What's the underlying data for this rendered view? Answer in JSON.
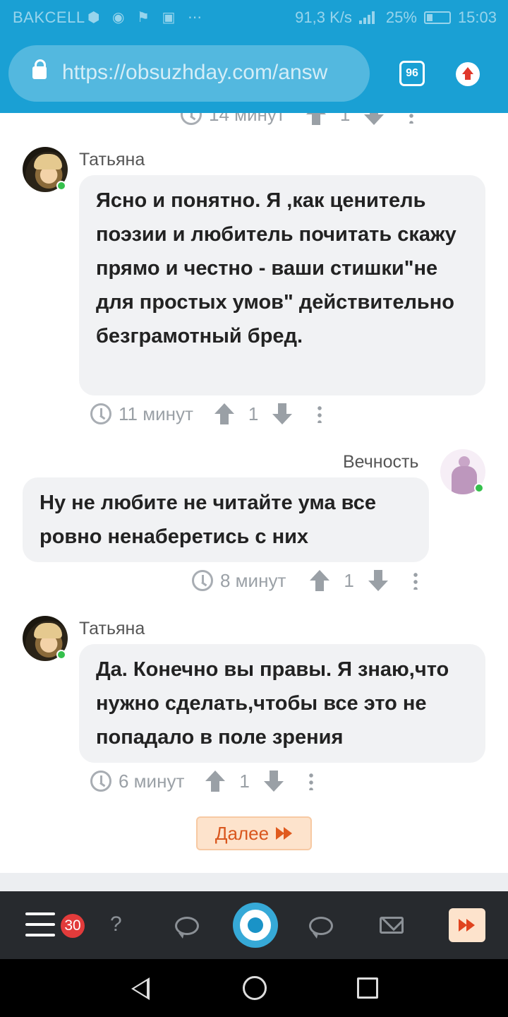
{
  "status_bar": {
    "carrier": "BAKCELL",
    "speed": "91,3 K/s",
    "battery": "25%",
    "time": "15:03"
  },
  "browser": {
    "url": "https://obsuzhday.com/answ",
    "tab_count": "96"
  },
  "comments": [
    {
      "author": "Татьяна",
      "text": "Ясно и понятно. Я ,как ценитель поэзии и любитель почитать скажу прямо и честно - ваши стишки\"не для простых умов\" действительно безграмотный бред.",
      "time": "11 минут",
      "votes": "1"
    },
    {
      "author": "Вечность",
      "text": "Ну не любите не читайте ума все ровно ненаберетись с них",
      "time": "8 минут",
      "votes": "1"
    },
    {
      "author": "Татьяна",
      "text": "Да. Конечно вы правы. Я знаю,что нужно сделать,чтобы все это не попадало в поле зрения",
      "time": "6 минут",
      "votes": "1"
    }
  ],
  "previous_meta": {
    "time": "14 минут",
    "votes": "1"
  },
  "next_button": "Далее",
  "bottom_nav": {
    "badge": "30"
  },
  "colors": {
    "accent": "#1aa0d4",
    "bubble": "#f1f2f4",
    "next": "#fde3cc"
  }
}
